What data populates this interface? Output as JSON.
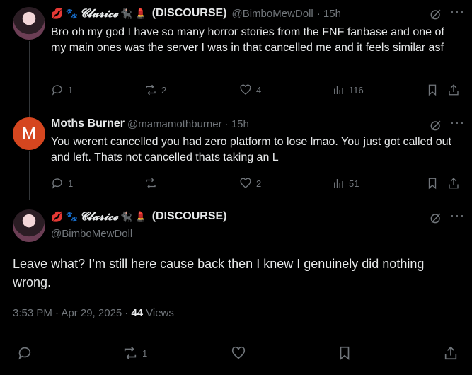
{
  "tweet1": {
    "display_name_emoji_1": "💋",
    "display_name_emoji_2": "🐾",
    "display_name_styled": "𝓒𝓵𝓪𝓻𝓲𝓬𝓮",
    "display_name_emoji_3": "🐈‍⬛",
    "display_name_emoji_4": "💄",
    "display_name_suffix": "(DISCOURSE)",
    "handle": "@BimboMewDoll",
    "time": "· 15h",
    "text": "Bro oh my god I have so many horror stories from the FNF fanbase and one of my main ones was the server I was in that cancelled me and it feels similar asf",
    "replies": "1",
    "reposts": "2",
    "likes": "4",
    "views": "116"
  },
  "tweet2": {
    "avatar_letter": "M",
    "display_name": "Moths Burner",
    "handle": "@mamamothburner",
    "time": "· 15h",
    "text": "You werent cancelled you had zero platform to lose lmao. You just got called out and left. Thats not cancelled thats taking an L",
    "replies": "1",
    "reposts": "",
    "likes": "2",
    "views": "51"
  },
  "main": {
    "display_name_emoji_1": "💋",
    "display_name_emoji_2": "🐾",
    "display_name_styled": "𝓒𝓵𝓪𝓻𝓲𝓬𝓮",
    "display_name_emoji_3": "🐈‍⬛",
    "display_name_emoji_4": "💄",
    "display_name_suffix": "(DISCOURSE)",
    "handle": "@BimboMewDoll",
    "text": "Leave what?  I’m still here cause back then I knew I genuinely did nothing wrong.",
    "timestamp": "3:53 PM · Apr 29, 2025 ·",
    "views_count": "44",
    "views_label": "Views",
    "reposts": "1"
  },
  "colors": {
    "background": "#000000",
    "text": "#e7e9ea",
    "muted": "#71767b",
    "divider": "#2f3336",
    "avatar_m": "#d5461f"
  }
}
